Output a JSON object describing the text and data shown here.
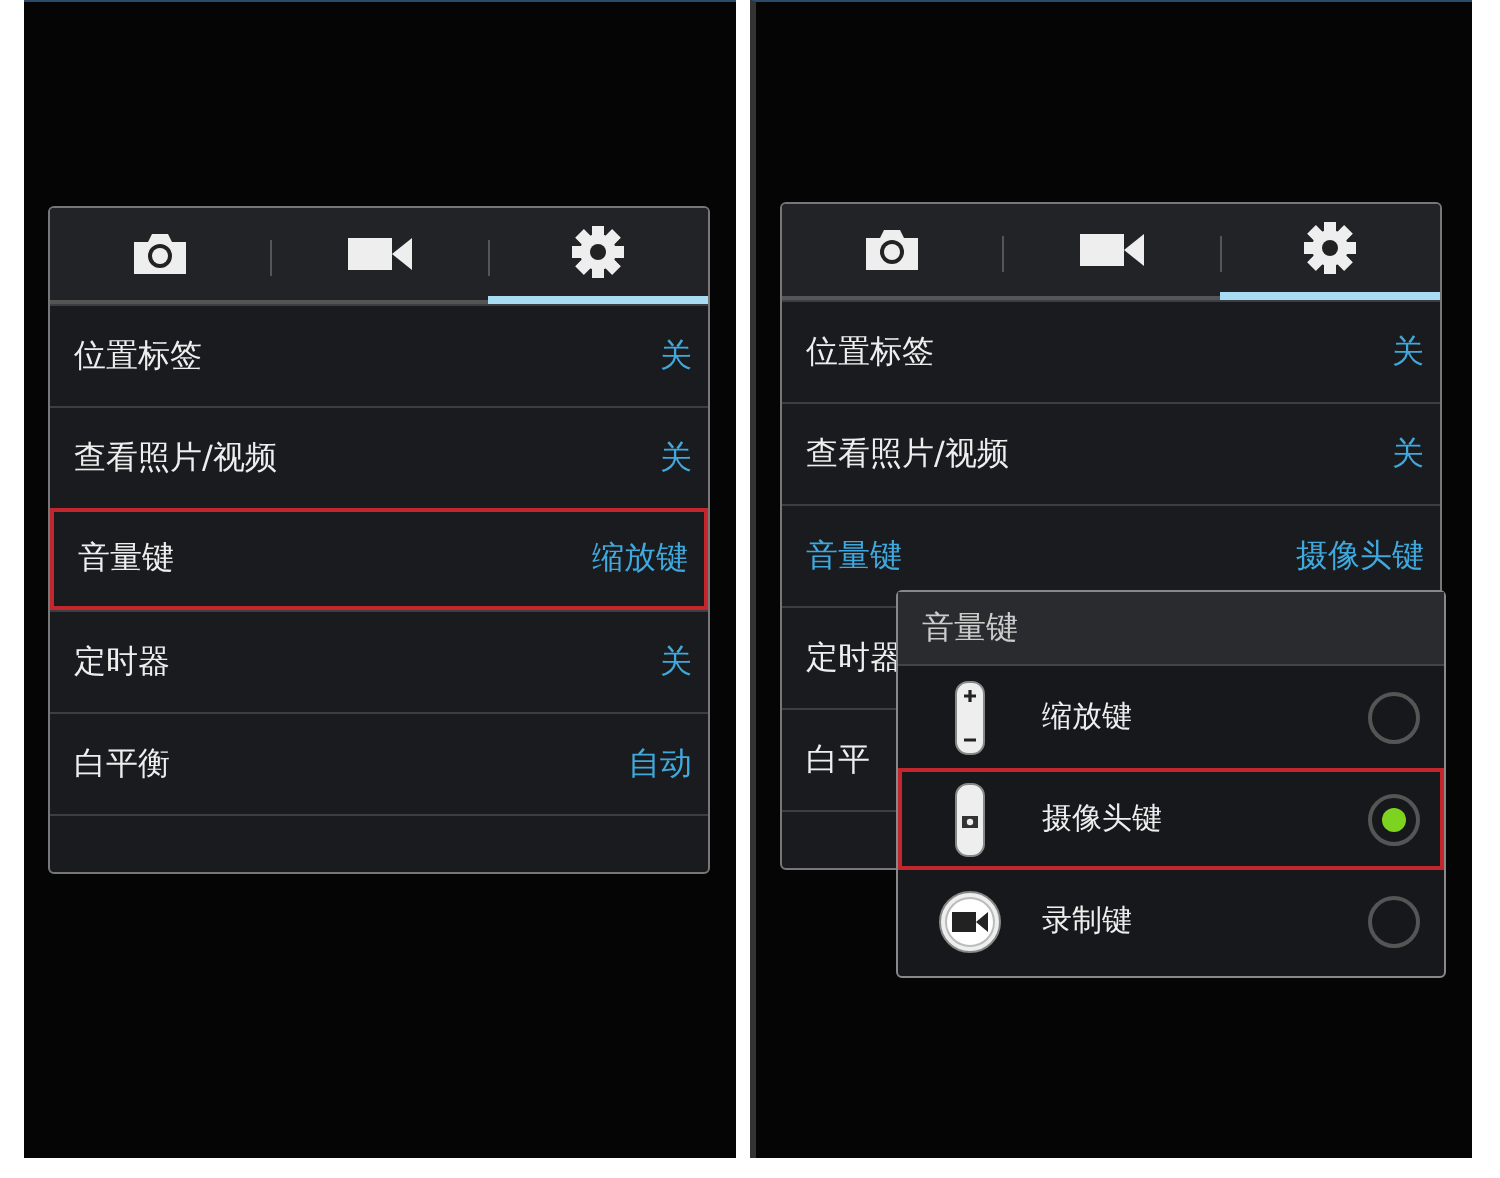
{
  "screens": [
    {
      "tabs": [
        {
          "kind": "camera",
          "selected": false
        },
        {
          "kind": "video",
          "selected": false
        },
        {
          "kind": "settings",
          "selected": true
        }
      ],
      "rows": [
        {
          "label": "位置标签",
          "value": "关",
          "highlighted": false,
          "active": false
        },
        {
          "label": "查看照片/视频",
          "value": "关",
          "highlighted": false,
          "active": false
        },
        {
          "label": "音量键",
          "value": "缩放键",
          "highlighted": true,
          "active": false
        },
        {
          "label": "定时器",
          "value": "关",
          "highlighted": false,
          "active": false
        },
        {
          "label": "白平衡",
          "value": "自动",
          "highlighted": false,
          "active": false
        }
      ]
    },
    {
      "tabs": [
        {
          "kind": "camera",
          "selected": false
        },
        {
          "kind": "video",
          "selected": false
        },
        {
          "kind": "settings",
          "selected": true
        }
      ],
      "rows": [
        {
          "label": "位置标签",
          "value": "关",
          "highlighted": false,
          "active": false
        },
        {
          "label": "查看照片/视频",
          "value": "关",
          "highlighted": false,
          "active": false
        },
        {
          "label": "音量键",
          "value": "摄像头键",
          "highlighted": false,
          "active": true
        },
        {
          "label": "定时器",
          "highlighted": false,
          "active": false
        },
        {
          "label": "白平",
          "highlighted": false,
          "active": false
        }
      ],
      "dialog": {
        "title": "音量键",
        "options": [
          {
            "kind": "zoom",
            "label": "缩放键",
            "selected": false,
            "highlighted": false
          },
          {
            "kind": "camera",
            "label": "摄像头键",
            "selected": true,
            "highlighted": true
          },
          {
            "kind": "record",
            "label": "录制键",
            "selected": false,
            "highlighted": false
          }
        ]
      }
    }
  ]
}
